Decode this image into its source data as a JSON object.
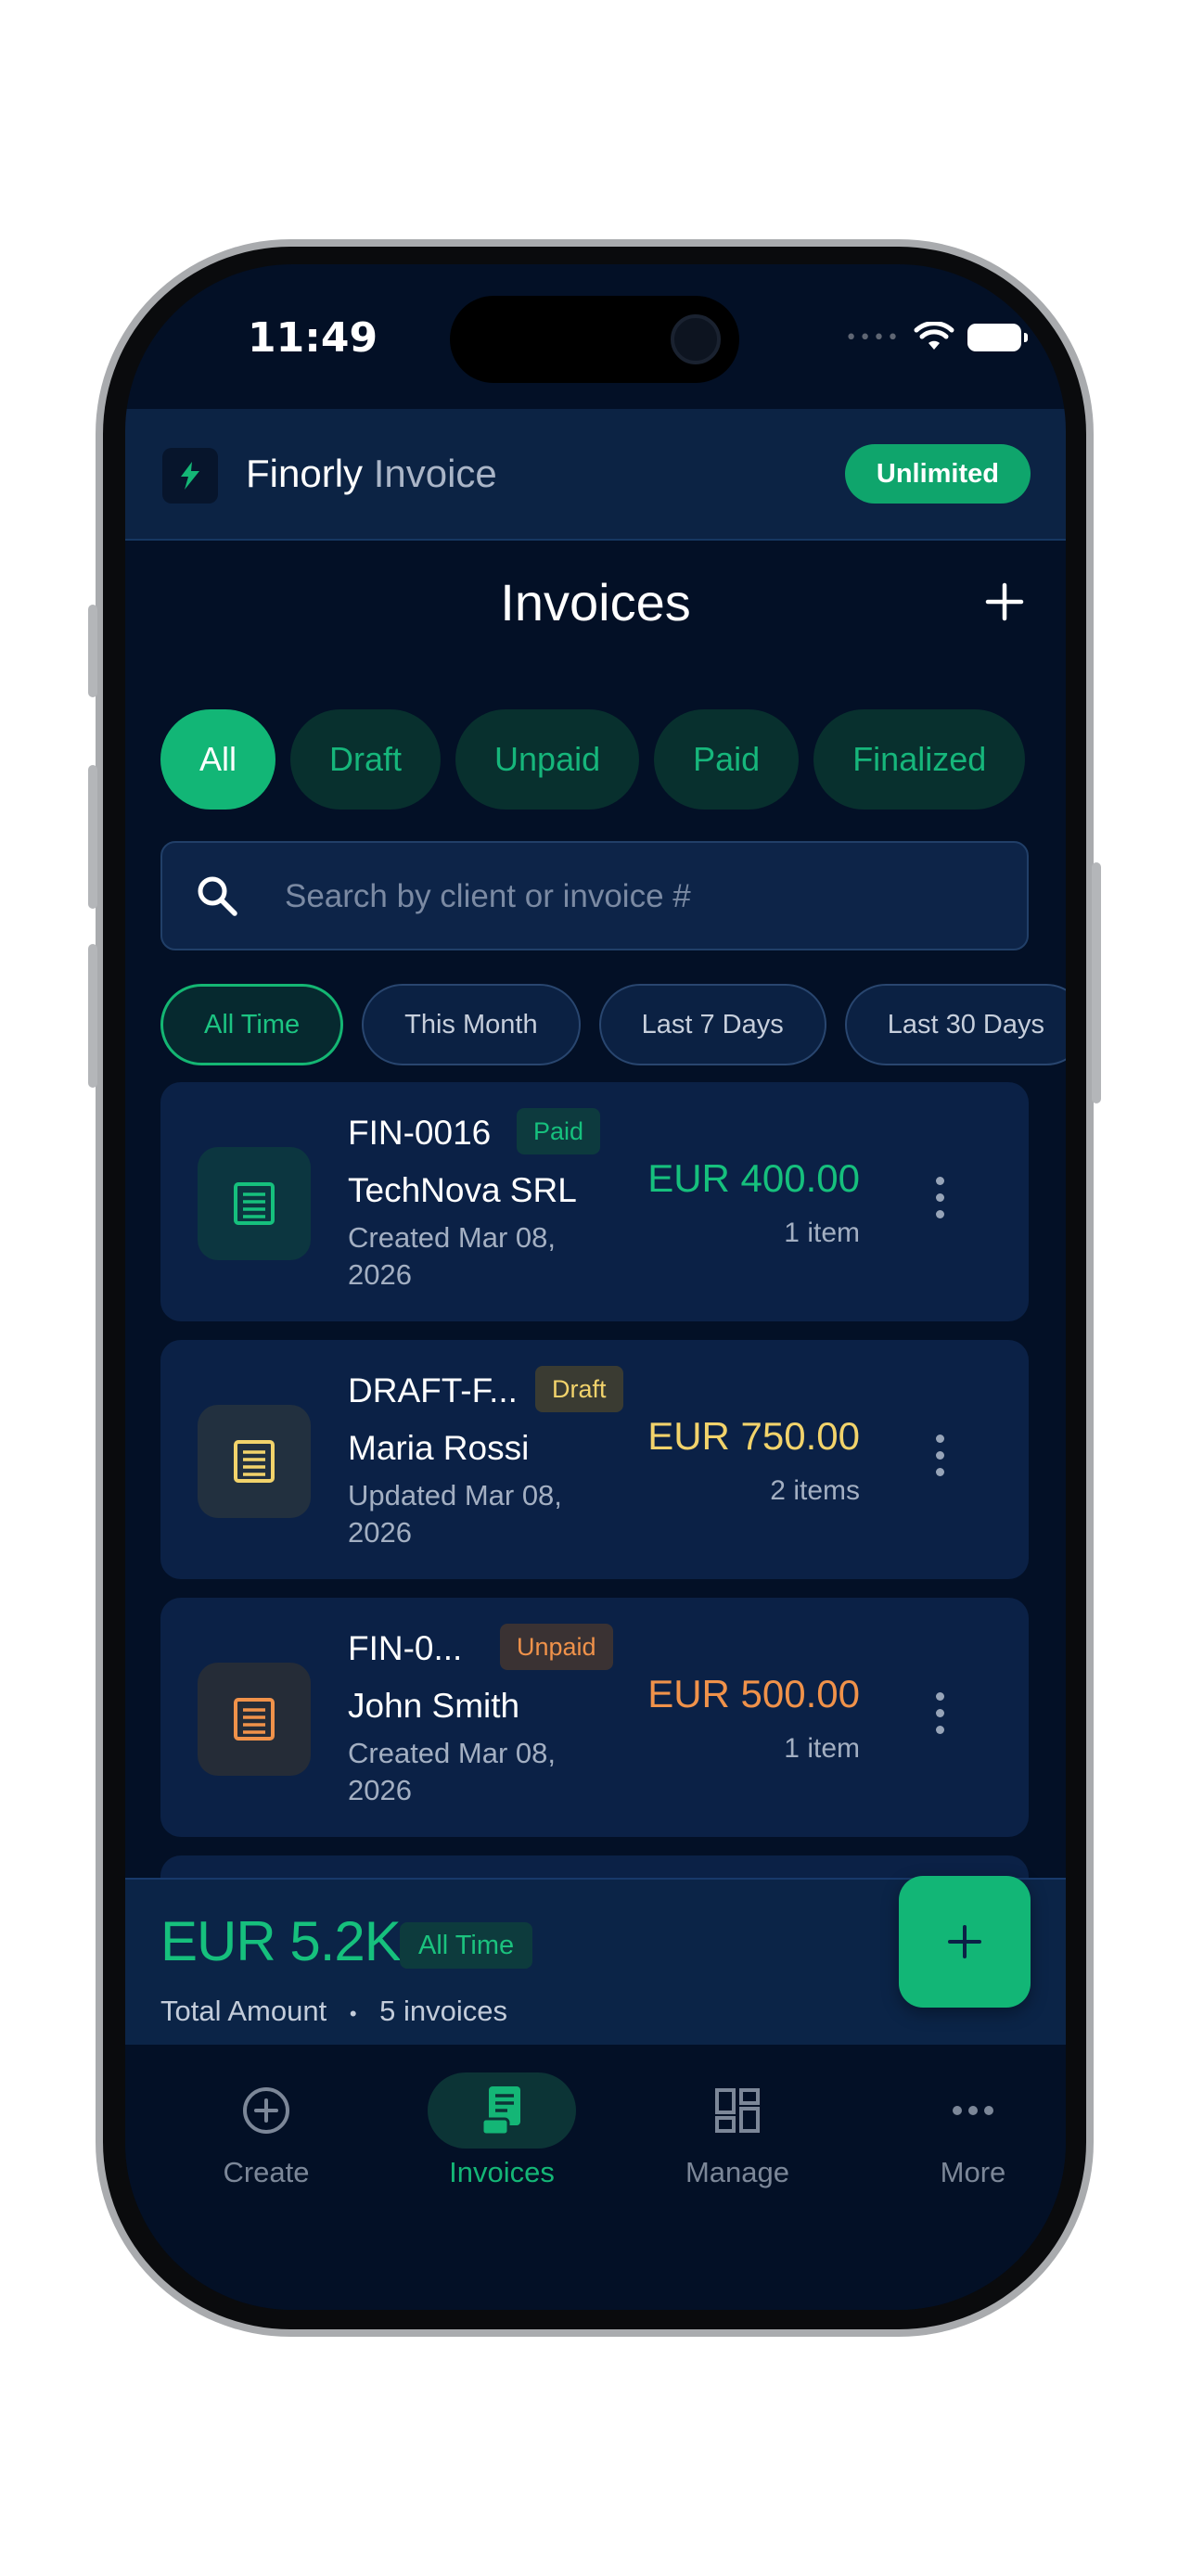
{
  "status_bar": {
    "time": "11:49"
  },
  "app": {
    "name": "Finorly",
    "name_suffix": "Invoice",
    "plan_badge": "Unlimited"
  },
  "page": {
    "title": "Invoices"
  },
  "status_filters": [
    {
      "label": "All",
      "active": true
    },
    {
      "label": "Draft",
      "active": false
    },
    {
      "label": "Unpaid",
      "active": false
    },
    {
      "label": "Paid",
      "active": false
    },
    {
      "label": "Finalized",
      "active": false
    }
  ],
  "search": {
    "placeholder": "Search by client or invoice #",
    "value": ""
  },
  "time_filters": [
    {
      "label": "All Time",
      "active": true
    },
    {
      "label": "This Month",
      "active": false
    },
    {
      "label": "Last 7 Days",
      "active": false
    },
    {
      "label": "Last 30 Days",
      "active": false
    }
  ],
  "invoices": [
    {
      "number": "FIN-0016",
      "status": "Paid",
      "client": "TechNova SRL",
      "date": "Created Mar 08, 2026",
      "amount": "EUR 400.00",
      "items": "1 item",
      "color": "#16c07d"
    },
    {
      "number": "DRAFT-F...",
      "status": "Draft",
      "client": "Maria Rossi",
      "date": "Updated Mar 08, 2026",
      "amount": "EUR 750.00",
      "items": "2 items",
      "color": "#f2d36b"
    },
    {
      "number": "FIN-0...",
      "status": "Unpaid",
      "client": "John Smith",
      "date": "Created Mar 08, 2026",
      "amount": "EUR 500.00",
      "items": "1 item",
      "color": "#f0924a"
    }
  ],
  "summary": {
    "amount": "EUR 5.2K",
    "period": "All Time",
    "label": "Total Amount",
    "separator": "•",
    "count": "5 invoices"
  },
  "tabs": [
    {
      "label": "Create",
      "icon": "plus-circle-icon",
      "active": false
    },
    {
      "label": "Invoices",
      "icon": "receipt-icon",
      "active": true
    },
    {
      "label": "Manage",
      "icon": "grid-icon",
      "active": false
    },
    {
      "label": "More",
      "icon": "ellipsis-icon",
      "active": false
    }
  ],
  "colors": {
    "accent": "#12b676",
    "background": "#031026",
    "card": "#0b2146"
  }
}
